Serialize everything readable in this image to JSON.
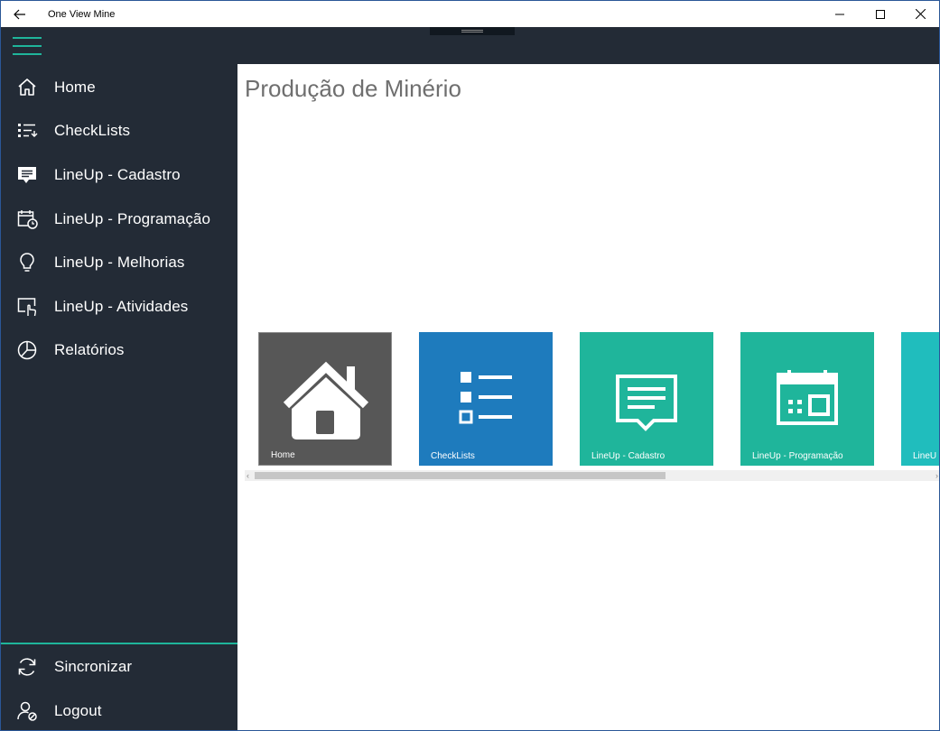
{
  "window": {
    "title": "One View Mine",
    "back_icon": "back-arrow-icon",
    "controls": [
      "minimize-icon",
      "maximize-icon",
      "close-icon"
    ]
  },
  "sidebar": {
    "items": [
      {
        "label": "Home",
        "icon": "home-icon"
      },
      {
        "label": "CheckLists",
        "icon": "checklist-icon"
      },
      {
        "label": "LineUp - Cadastro",
        "icon": "message-icon"
      },
      {
        "label": "LineUp - Programação",
        "icon": "calendar-clock-icon"
      },
      {
        "label": "LineUp - Melhorias",
        "icon": "lightbulb-icon"
      },
      {
        "label": "LineUp - Atividades",
        "icon": "touch-screen-icon"
      },
      {
        "label": "Relatórios",
        "icon": "pie-chart-icon"
      }
    ],
    "footer_items": [
      {
        "label": "Sincronizar",
        "icon": "sync-icon"
      },
      {
        "label": "Logout",
        "icon": "user-logout-icon"
      }
    ]
  },
  "main": {
    "title": "Produção de Minério",
    "tiles": [
      {
        "label": "Home",
        "icon": "home-icon",
        "color": "#575757"
      },
      {
        "label": "CheckLists",
        "icon": "list-icon",
        "color": "#1e7bbd"
      },
      {
        "label": "LineUp - Cadastro",
        "icon": "message-icon",
        "color": "#1fb59b"
      },
      {
        "label": "LineUp - Programação",
        "icon": "calendar-icon",
        "color": "#1fb59b"
      },
      {
        "label": "LineU",
        "icon": "tile-partial",
        "color": "#20bdbd"
      }
    ]
  },
  "colors": {
    "accent": "#1fb59b",
    "sidebar_bg": "#232b36",
    "title_text": "#6f6f6f"
  }
}
